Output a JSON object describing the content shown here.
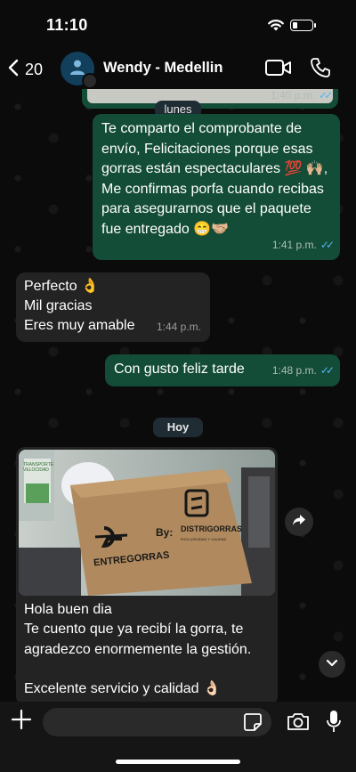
{
  "status_bar": {
    "time": "11:10"
  },
  "header": {
    "back_count": "20",
    "contact_name": "Wendy - Medellin"
  },
  "messages": {
    "top_image_time": "1:40 p.m.",
    "date_monday": "lunes",
    "m1": {
      "text": "Te comparto el comprobante de envío, Felicitaciones porque esas gorras están espectaculares 💯 🙌🏼, Me confirmas porfa cuando recibas para asegurarnos que el paquete fue entregado 😁🤝🏼",
      "time": "1:41 p.m."
    },
    "m2": {
      "lines": [
        "Perfecto 👌",
        "Mil gracias",
        "Eres muy amable"
      ],
      "time": "1:44 p.m."
    },
    "m3": {
      "text": "Con gusto feliz tarde",
      "time": "1:48 p.m."
    },
    "date_today": "Hoy",
    "m4": {
      "image_text_left": "ENTREGORRAS",
      "image_text_by": "By:",
      "image_text_right": "DISTRIGORRAS",
      "image_text_tagline": "EXCLUSIVIDAD Y CALIDAD",
      "image_wall_sign": "TRANSPORTE VELOCIDAD",
      "lines": [
        "Hola buen dia",
        "Te cuento que ya recibí  la gorra, te agradezco enormemente la gestión.",
        "Excelente servicio y calidad 👌🏻"
      ]
    }
  },
  "colors": {
    "outgoing": "#144d37",
    "incoming": "#232324",
    "read_ticks": "#55b4f1"
  },
  "icons": [
    "back-chevron-icon",
    "user-icon",
    "video-icon",
    "phone-icon",
    "share-icon",
    "chevron-down-icon",
    "plus-icon",
    "sticker-icon",
    "camera-icon",
    "mic-icon",
    "wifi-icon",
    "battery-icon"
  ]
}
